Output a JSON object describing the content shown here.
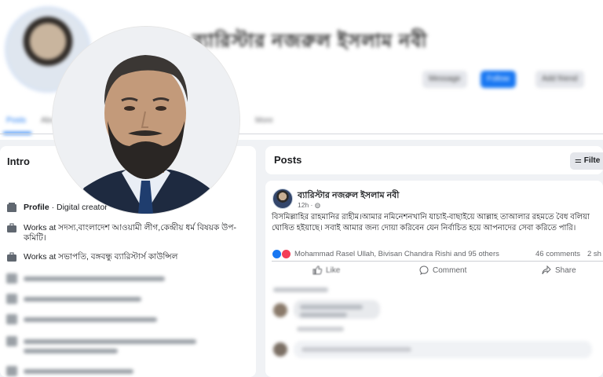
{
  "header": {
    "name": "ব্যারিস্টার নজরুল ইসলাম নবী",
    "buttons": [
      "Message",
      "Follow",
      "Add friend"
    ],
    "tabs": [
      "Posts",
      "About",
      "More"
    ]
  },
  "intro": {
    "title": "Intro",
    "rows": [
      {
        "icon": "profile-icon",
        "strong": "Profile",
        "text": " · Digital creator"
      },
      {
        "icon": "briefcase-icon",
        "text": "Works at সদস্য,বাংলাদেশ আওয়ামী লীগ,কেন্দ্রীয় ধর্ম বিষয়ক উপ-কমিটি।"
      },
      {
        "icon": "briefcase-icon",
        "text": "Works at সভাপতি, বঙ্গবন্ধু ব্যারিস্টার্স কাউন্সিল"
      }
    ]
  },
  "posts": {
    "title": "Posts",
    "filter_label": "Filte",
    "post": {
      "author": "ব্যারিস্টার নজরুল ইসলাম নবী",
      "time": "12h ·",
      "text": "বিসমিল্লাহির রাহমানির রাহীম।আমার নমিনেশনখানি যাচাই-বাছাইয়ে   আল্লাহ তাআলার রহমতে বৈধ বলিয়া ঘোষিত হইয়াছে। সবাই আমার জন্য দোয়া  করিবেন যেন নির্বাচিত হয়ে আপনাদের সেবা করিতে পারি।",
      "reactions_text": "Mohammad Rasel Ullah, Bivisan Chandra Rishi and 95 others",
      "comments_text": "46 comments",
      "shares_text": "2 sh",
      "actions": {
        "like": "Like",
        "comment": "Comment",
        "share": "Share"
      }
    }
  },
  "colors": {
    "accent": "#1877f2",
    "background": "#f0f2f5",
    "card": "#ffffff"
  }
}
